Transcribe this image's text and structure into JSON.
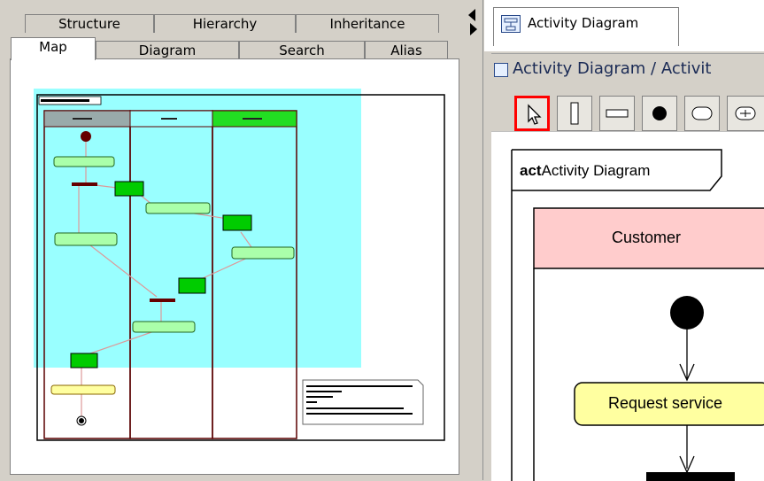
{
  "left_tabs_row1": [
    "Structure",
    "Hierarchy",
    "Inheritance"
  ],
  "left_tabs_row2": [
    "Map",
    "Diagram",
    "Search",
    "Alias"
  ],
  "active_left_tab": "Map",
  "right_tab": {
    "icon": "activity-diagram-icon",
    "label": "Activity Diagram"
  },
  "breadcrumb": "Activity Diagram / Activit",
  "toolbar_tools": [
    "pointer-tool",
    "partition-vertical-tool",
    "partition-horizontal-tool",
    "initial-node-tool",
    "action-tool",
    "merge-tool"
  ],
  "diagram": {
    "frame_kind": "act",
    "frame_name": "Activity Diagram",
    "swimlane": "Customer",
    "action": "Request service"
  },
  "colors": {
    "map_viewport": "#99ffff",
    "lane_header_pink": "#ffcccc",
    "action_yellow": "#ffffa0",
    "tool_highlight": "#ff0000"
  }
}
